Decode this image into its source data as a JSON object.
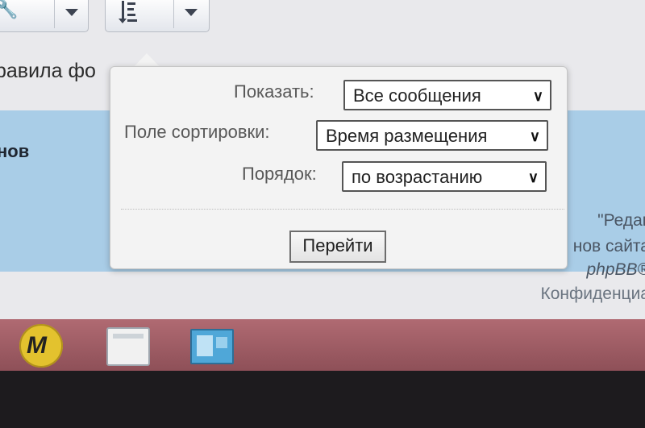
{
  "page": {
    "text_rules_fragment": "равила фо",
    "heading_fragment": "нов",
    "footer_lines": [
      "\"Редак",
      "нов сайта",
      "phpBB®",
      "Конфиденциа"
    ]
  },
  "sort_popup": {
    "show_label": "Показать:",
    "show_value": "Все сообщения",
    "sort_field_label": "Поле сортировки:",
    "sort_field_value": "Время размещения",
    "order_label": "Порядок:",
    "order_value": "по возрастанию",
    "go_button": "Перейти"
  },
  "icons": {
    "toolbar_tools": "wrench-icon",
    "toolbar_sort": "sort-icon",
    "dropdown": "chevron-down-icon"
  }
}
